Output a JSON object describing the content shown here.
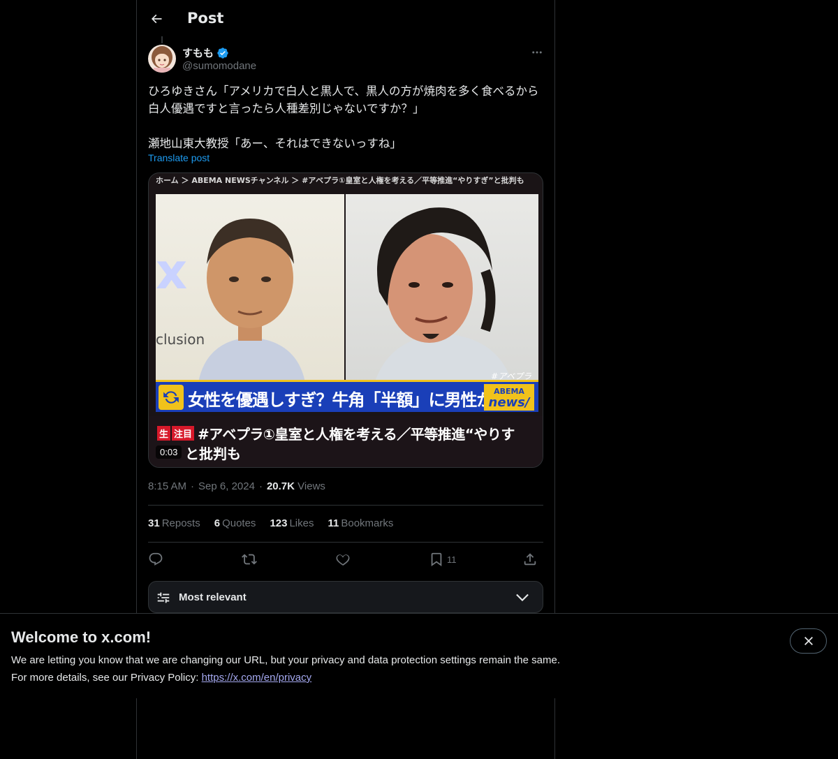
{
  "header": {
    "title": "Post"
  },
  "author": {
    "name": "すもも",
    "handle": "@sumomodane",
    "verified": true
  },
  "post": {
    "text": "ひろゆきさん「アメリカで白人と黒人で、黒人の方が焼肉を多く食べるから白人優遇ですと言ったら人種差別じゃないですか？」\n\n瀬地山東大教授「あー、それはできないっすね」",
    "translate_label": "Translate post"
  },
  "media": {
    "breadcrumb": "ホーム ＞ ABEMA NEWSチャンネル ＞ #アベプラ①皇室と人権を考える／平等推進“やりすぎ”と批判も",
    "left_logo_glyph": "x",
    "left_logo_text": "clusion",
    "corner_hashtag": "#アベプラ",
    "headline": "女性を優遇しすぎ？牛角「半額」に男性が批判",
    "news_logo_line1": "ABEMA",
    "news_logo_line2": "news/",
    "tag_live": "生",
    "tag_hot": "注目",
    "caption_line1": "#アベプラ①皇室と人権を考える／平等推進“やりす",
    "caption_line2": "と批判も",
    "duration": "0:03"
  },
  "meta": {
    "time": "8:15 AM",
    "sep": "·",
    "date": "Sep 6, 2024",
    "views_count": "20.7K",
    "views_label": "Views"
  },
  "stats": [
    {
      "count": "31",
      "label": "Reposts"
    },
    {
      "count": "6",
      "label": "Quotes"
    },
    {
      "count": "123",
      "label": "Likes"
    },
    {
      "count": "11",
      "label": "Bookmarks"
    }
  ],
  "actions": {
    "bookmark_count": "11"
  },
  "sort": {
    "label": "Most relevant"
  },
  "banner": {
    "title": "Welcome to x.com!",
    "line1": "We are letting you know that we are changing our URL, but your privacy and data protection settings remain the same.",
    "line2_prefix": "For more details, see our Privacy Policy: ",
    "link": "https://x.com/en/privacy"
  },
  "colors": {
    "accent": "#1d9bf0",
    "muted": "#71767b",
    "text": "#e7e9ea",
    "border": "#2f3336",
    "link": "#a5a9f0"
  }
}
